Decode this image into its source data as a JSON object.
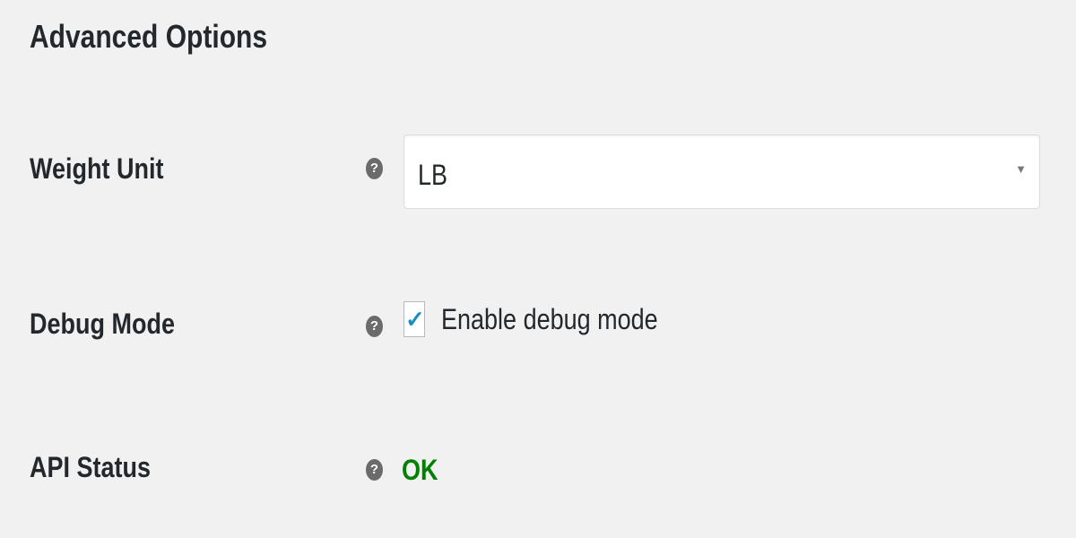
{
  "section_title": "Advanced Options",
  "fields": {
    "weight_unit": {
      "label": "Weight Unit",
      "help_icon": "question-circle-icon",
      "value": "LB"
    },
    "debug_mode": {
      "label": "Debug Mode",
      "help_icon": "question-circle-icon",
      "checkbox_label": "Enable debug mode",
      "checked": true
    },
    "api_status": {
      "label": "API Status",
      "help_icon": "question-circle-icon",
      "value": "OK",
      "value_color": "#008000"
    }
  },
  "icons": {
    "help": "?",
    "dropdown": "▼",
    "check": "✓"
  },
  "colors": {
    "background": "#f1f1f1",
    "checkmark": "#1e8cbe"
  }
}
